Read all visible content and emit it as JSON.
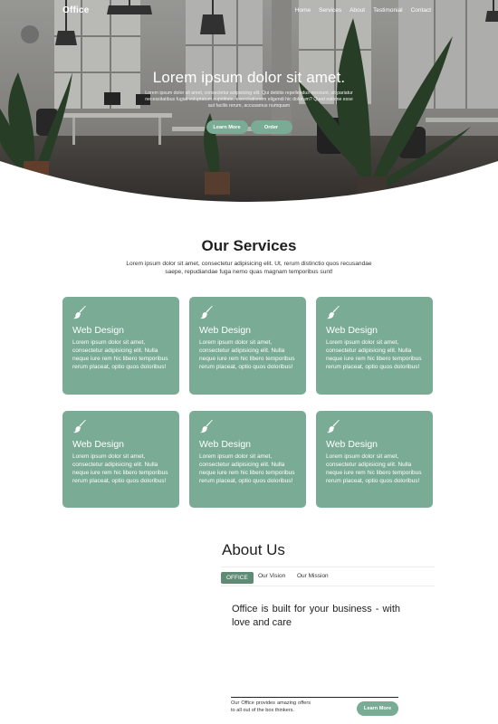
{
  "nav": {
    "brand": "Office",
    "links": [
      "Home",
      "Services",
      "About",
      "Testimonial",
      "Contact"
    ]
  },
  "hero": {
    "title": "Lorem ipsum dolor sit amet.",
    "text": "Lorem ipsum dolor sit amet, consectetur adipisicing elit. Qui debitis repellendus nesciunt, sit pariatur necessitatibus fugiat voluptatum cupiditate, exercitationem eligendi hic dolorum? Quod natione esse aut facilis rerum, accusamus numquam",
    "learn_label": "Learn More",
    "order_label": "Order"
  },
  "services": {
    "title": "Our Services",
    "subtitle": "Lorem ipsum dolor sit amet, consectetur adipisicing elit. Ut, rerum distinctio quos recusandae saepe, repudiandae fuga nemo quas magnam temporibus sunt!",
    "cards": [
      {
        "icon": "paintbrush-icon",
        "title": "Web Design",
        "text": "Lorem ipsum dolor sit amet, consectetur adipisicing elit. Nulla neque iure rem hic libero temporibus rerum placeat, optio quos doloribus!"
      },
      {
        "icon": "paintbrush-icon",
        "title": "Web Design",
        "text": "Lorem ipsum dolor sit amet, consectetur adipisicing elit. Nulla neque iure rem hic libero temporibus rerum placeat, optio quos doloribus!"
      },
      {
        "icon": "paintbrush-icon",
        "title": "Web Design",
        "text": "Lorem ipsum dolor sit amet, consectetur adipisicing elit. Nulla neque iure rem hic libero temporibus rerum placeat, optio quos doloribus!"
      },
      {
        "icon": "paintbrush-icon",
        "title": "Web Design",
        "text": "Lorem ipsum dolor sit amet, consectetur adipisicing elit. Nulla neque iure rem hic libero temporibus rerum placeat, optio quos doloribus!"
      },
      {
        "icon": "paintbrush-icon",
        "title": "Web Design",
        "text": "Lorem ipsum dolor sit amet, consectetur adipisicing elit. Nulla neque iure rem hic libero temporibus rerum placeat, optio quos doloribus!"
      },
      {
        "icon": "paintbrush-icon",
        "title": "Web Design",
        "text": "Lorem ipsum dolor sit amet, consectetur adipisicing elit. Nulla neque iure rem hic libero temporibus rerum placeat, optio quos doloribus!"
      }
    ]
  },
  "about": {
    "title": "About Us",
    "tabs": [
      "OFFICE",
      "Our Vision",
      "Our Mission"
    ],
    "active_tab": "OFFICE",
    "heading": "Office is built for your business - with love and care",
    "blurb": "Our Office provides amazing offers to all out of the box thinkers.",
    "learn_label": "Learn More"
  },
  "colors": {
    "accent": "#7aab95",
    "accent_dark": "#5f8a76",
    "text": "#1f1f1f",
    "white": "#ffffff"
  }
}
